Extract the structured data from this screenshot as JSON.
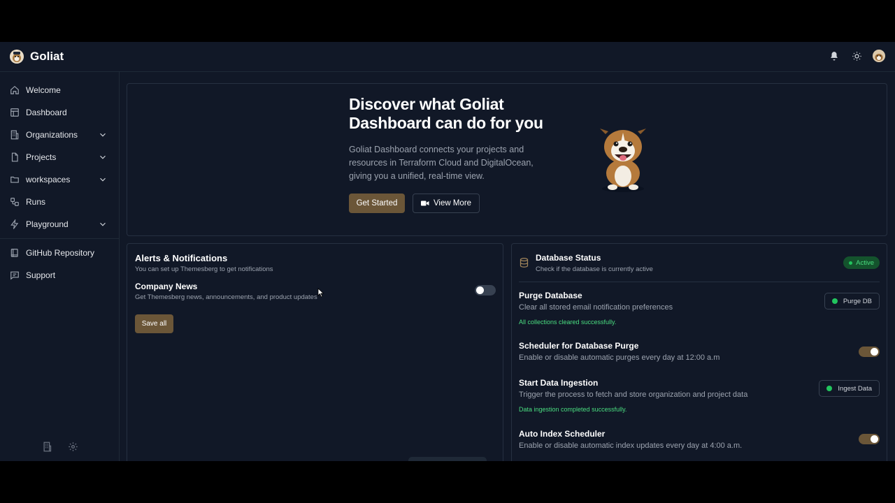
{
  "app": {
    "title": "Goliat"
  },
  "header": {
    "icons": [
      "bell-icon",
      "sun-icon",
      "user-avatar"
    ]
  },
  "sidebar": {
    "items": [
      {
        "label": "Welcome",
        "icon": "home-icon",
        "expandable": false
      },
      {
        "label": "Dashboard",
        "icon": "table-icon",
        "expandable": false
      },
      {
        "label": "Organizations",
        "icon": "building-icon",
        "expandable": true
      },
      {
        "label": "Projects",
        "icon": "file-icon",
        "expandable": true
      },
      {
        "label": "workspaces",
        "icon": "folder-icon",
        "expandable": true
      },
      {
        "label": "Runs",
        "icon": "workflow-icon",
        "expandable": false
      },
      {
        "label": "Playground",
        "icon": "bolt-icon",
        "expandable": true
      },
      {
        "label": "GitHub Repository",
        "icon": "book-icon",
        "expandable": false
      },
      {
        "label": "Support",
        "icon": "chat-icon",
        "expandable": false
      }
    ],
    "bottom_icons": [
      "building-icon",
      "gear-icon"
    ]
  },
  "hero": {
    "title": "Discover what Goliat Dashboard can do for you",
    "description": "Goliat Dashboard connects your projects and resources in Terraform Cloud and DigitalOcean, giving you a unified, real-time view.",
    "primary_label": "Get Started",
    "secondary_label": "View More"
  },
  "alerts": {
    "title": "Alerts & Notifications",
    "subtitle": "You can set up Themesberg to get notifications",
    "company_news_title": "Company News",
    "company_news_desc": "Get Themesberg news, announcements, and product updates",
    "company_news_enabled": false,
    "save_label": "Save all"
  },
  "database": {
    "title": "Database Status",
    "subtitle": "Check if the database is currently active",
    "status": "Active",
    "purge": {
      "title": "Purge Database",
      "desc": "Clear all stored email notification preferences",
      "button": "Purge DB",
      "message": "All collections cleared successfully."
    },
    "scheduler": {
      "title": "Scheduler for Database Purge",
      "desc": "Enable or disable automatic purges every day at 12:00 a.m",
      "enabled": true
    },
    "ingestion": {
      "title": "Start Data Ingestion",
      "desc": "Trigger the process to fetch and store organization and project data",
      "button": "Ingest Data",
      "message": "Data ingestion completed successfully."
    },
    "auto_index": {
      "title": "Auto Index Scheduler",
      "desc": "Enable or disable automatic index updates every day at 4:00 a.m.",
      "enabled": true
    }
  },
  "colors": {
    "accent": "#6b5638",
    "background": "#111827",
    "success": "#22c55e"
  }
}
